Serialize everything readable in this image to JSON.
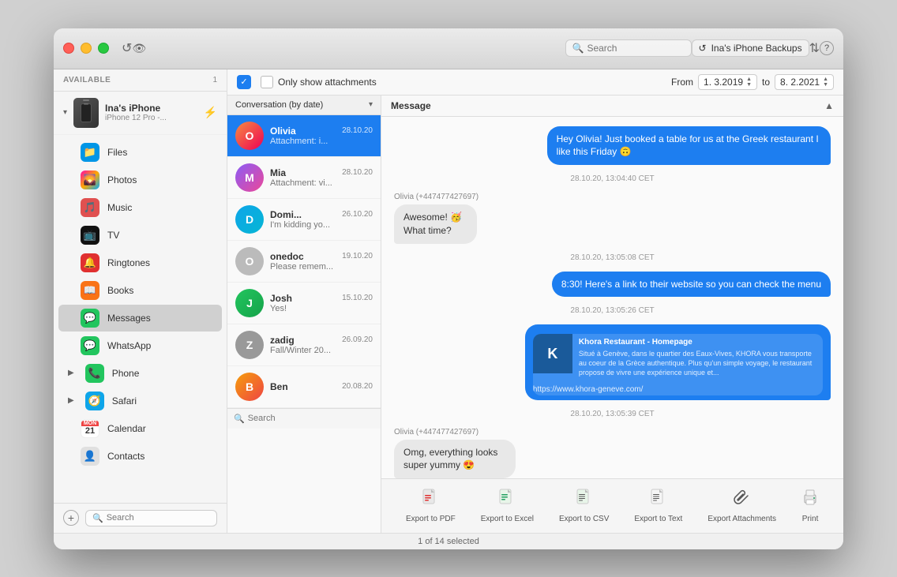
{
  "titleBar": {
    "searchPlaceholder": "Search",
    "deviceName": "Ina's iPhone Backups",
    "helpLabel": "?",
    "reloadIcon": "↺",
    "eyeIcon": "👁",
    "transferIcon": "⇅"
  },
  "sidebar": {
    "availableLabel": "AVAILABLE",
    "availableCount": "1",
    "device": {
      "name": "Ina's iPhone",
      "model": "iPhone 12 Pro -..."
    },
    "items": [
      {
        "label": "Files",
        "icon": "📁",
        "color": "#0096e6",
        "active": false
      },
      {
        "label": "Photos",
        "icon": "🌄",
        "color": "#e04040",
        "active": false
      },
      {
        "label": "Music",
        "icon": "🎵",
        "color": "#e05050",
        "active": false
      },
      {
        "label": "TV",
        "icon": "📺",
        "color": "#222",
        "active": false
      },
      {
        "label": "Ringtones",
        "icon": "🔔",
        "color": "#e03030",
        "active": false
      },
      {
        "label": "Books",
        "icon": "📖",
        "color": "#f97316",
        "active": false
      },
      {
        "label": "Messages",
        "icon": "💬",
        "color": "#22c55e",
        "active": true
      },
      {
        "label": "WhatsApp",
        "icon": "💬",
        "color": "#22c55e",
        "active": false
      },
      {
        "label": "Phone",
        "icon": "📞",
        "color": "#22c55e",
        "active": false
      },
      {
        "label": "Safari",
        "icon": "🧭",
        "color": "#0ea5e9",
        "active": false
      },
      {
        "label": "Calendar",
        "icon": "📅",
        "color": "#ef4444",
        "active": false
      },
      {
        "label": "Contacts",
        "icon": "👤",
        "color": "#aaa",
        "active": false
      }
    ],
    "searchPlaceholder": "Search"
  },
  "toolbar": {
    "attachmentsLabel": "Only show attachments",
    "fromLabel": "From",
    "toLabel": "to",
    "fromDate": "1. 3.2019",
    "toDate": "8. 2.2021",
    "sortLabel": "Conversation (by date)"
  },
  "conversations": [
    {
      "name": "Olivia",
      "date": "28.10.20",
      "preview": "Attachment: i...",
      "active": true,
      "avatarClass": "av-olivia",
      "initials": "O"
    },
    {
      "name": "Mia",
      "date": "28.10.20",
      "preview": "Attachment: vi...",
      "active": false,
      "avatarClass": "av-mia",
      "initials": "M"
    },
    {
      "name": "Domi...",
      "date": "26.10.20",
      "preview": "I'm kidding yo...",
      "active": false,
      "avatarClass": "av-domi",
      "initials": "D"
    },
    {
      "name": "onedoc",
      "date": "19.10.20",
      "preview": "Please remem...",
      "active": false,
      "avatarClass": "av-onedoc",
      "initials": "O"
    },
    {
      "name": "Josh",
      "date": "15.10.20",
      "preview": "Yes!",
      "active": false,
      "avatarClass": "av-josh",
      "initials": "J"
    },
    {
      "name": "zadig",
      "date": "26.09.20",
      "preview": "Fall/Winter 20...",
      "active": false,
      "avatarClass": "av-zadig",
      "initials": "Z"
    },
    {
      "name": "Ben",
      "date": "20.08.20",
      "preview": "",
      "active": false,
      "avatarClass": "av-ben",
      "initials": "B"
    }
  ],
  "messages": {
    "headerLabel": "Message",
    "senderLabel": "Olivia (+447477427697)",
    "items": [
      {
        "type": "sent",
        "text": "Hey Olivia! Just booked a table for us at the Greek restaurant I like this Friday 🙃",
        "timestamp": null
      },
      {
        "type": "timestamp",
        "text": "28.10.20, 13:04:40 CET"
      },
      {
        "type": "received",
        "text": "Awesome! 🥳 What time?",
        "timestamp": null
      },
      {
        "type": "timestamp",
        "text": "28.10.20, 13:05:08 CET"
      },
      {
        "type": "sent",
        "text": "8:30! Here's a link to their website so you can check the menu",
        "timestamp": null
      },
      {
        "type": "timestamp",
        "text": "28.10.20, 13:05:26 CET"
      },
      {
        "type": "sent-link",
        "text": "",
        "timestamp": null
      },
      {
        "type": "timestamp",
        "text": "28.10.20, 13:05:39 CET"
      },
      {
        "type": "received-sender",
        "text": "Omg, everything looks super yummy 😍",
        "timestamp": null
      }
    ],
    "linkPreview": {
      "title": "Khora Restaurant - Homepage",
      "logoText": "K",
      "description": "Situé à Genève, dans le quartier des Eaux-Vives, KHORA vous transporte au coeur de la Grèce authentique. Plus qu'un simple voyage, le restaurant propose de vivre une expérience unique et...",
      "url": "https://www.khora-geneve.com/"
    }
  },
  "bottomBar": {
    "buttons": [
      {
        "label": "Export to PDF",
        "icon": "📄"
      },
      {
        "label": "Export to Excel",
        "icon": "📊"
      },
      {
        "label": "Export to CSV",
        "icon": "📋"
      },
      {
        "label": "Export to Text",
        "icon": "📝"
      },
      {
        "label": "Export Attachments",
        "icon": "📎"
      },
      {
        "label": "Print",
        "icon": "🖨"
      }
    ],
    "statusText": "1 of 14 selected"
  }
}
